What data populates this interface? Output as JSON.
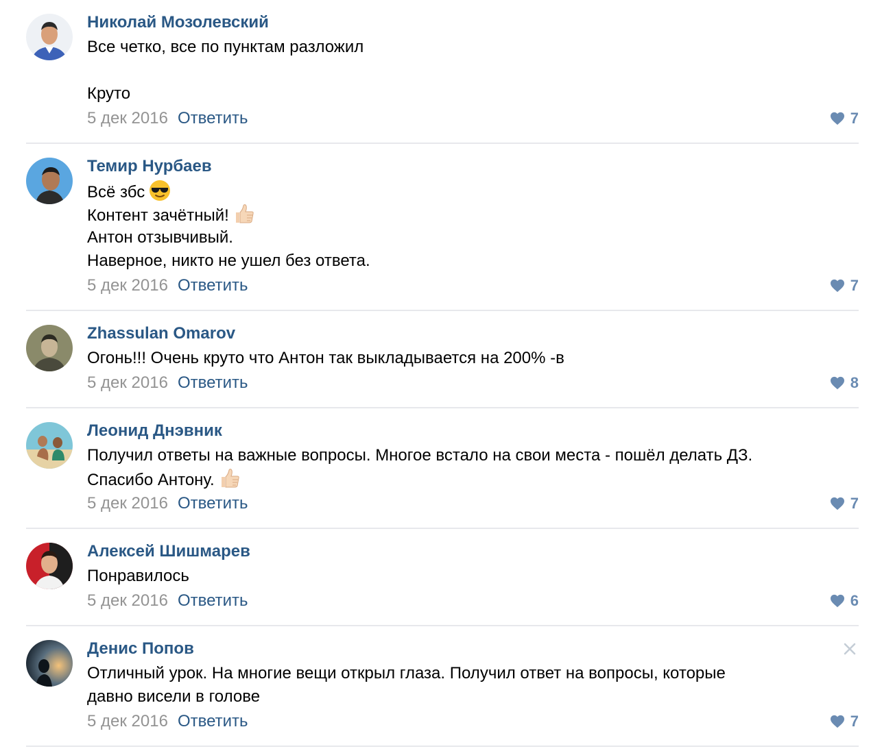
{
  "reply_label": "Ответить",
  "colors": {
    "author": "#2a5885",
    "date": "#939393",
    "like": "#6a8bb2",
    "divider": "#e7e8ec"
  },
  "comments": [
    {
      "author": "Николай Мозолевский",
      "lines": [
        "Все четко, все по пунктам разложил",
        "",
        "Круто"
      ],
      "date": "5 дек 2016",
      "likes": "7"
    },
    {
      "author": "Темир Нурбаев",
      "lines": [
        "Всё збс",
        "Контент зачётный!",
        "Антон отзывчивый.",
        "Наверное, никто не ушел без ответа."
      ],
      "emojis": [
        "sunglasses-emoji",
        "thumbs-up-emoji"
      ],
      "date": "5 дек 2016",
      "likes": "7"
    },
    {
      "author": "Zhassulan Omarov",
      "lines": [
        "Огонь!!! Очень круто что Антон так выкладывается на 200% -в"
      ],
      "date": "5 дек 2016",
      "likes": "8"
    },
    {
      "author": "Леонид Днэвник",
      "lines": [
        "Получил ответы на важные вопросы. Многое встало на свои места - пошёл делать ДЗ.",
        "Спасибо Антону."
      ],
      "emojis": [
        "thumbs-up-emoji"
      ],
      "date": "5 дек 2016",
      "likes": "7"
    },
    {
      "author": "Алексей Шишмарев",
      "lines": [
        "Понравилось"
      ],
      "date": "5 дек 2016",
      "likes": "6"
    },
    {
      "author": "Денис Попов",
      "lines": [
        "Отличный урок. На многие вещи открыл глаза. Получил ответ на вопросы, которые",
        "давно висели в голове"
      ],
      "date": "5 дек 2016",
      "likes": "7"
    }
  ]
}
